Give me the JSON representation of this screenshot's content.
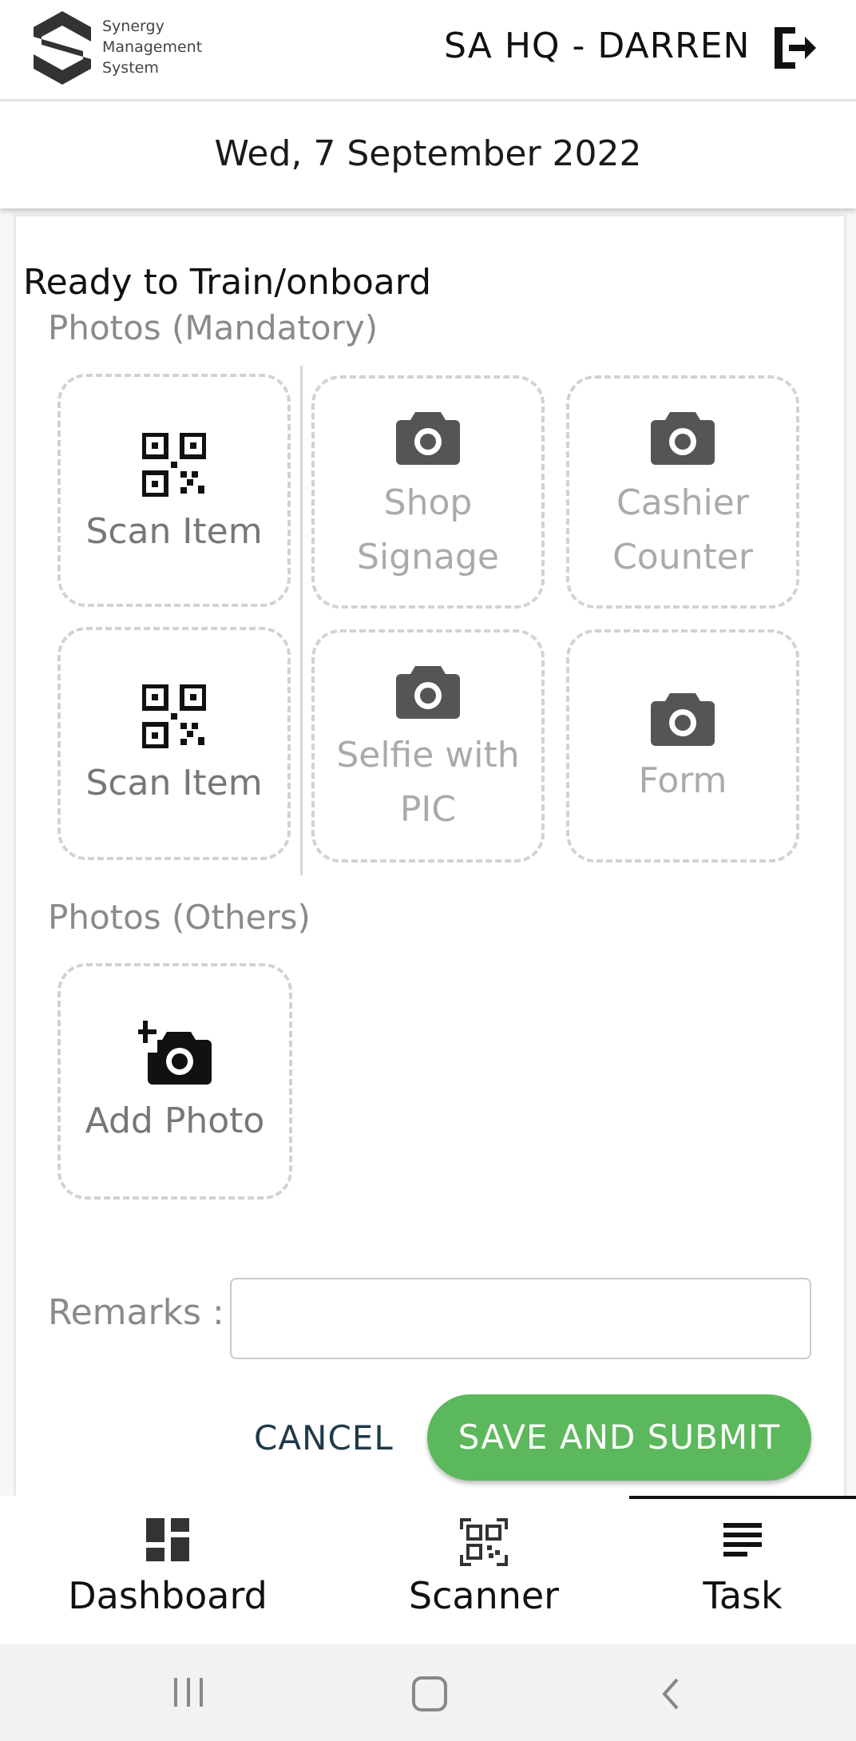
{
  "header": {
    "logo_text": [
      "Synergy",
      "Management",
      "System"
    ],
    "user": "SA HQ - DARREN"
  },
  "date": "Wed, 7 September 2022",
  "task": {
    "title": "Ready to Train/onboard",
    "photos_mandatory_label": "Photos (Mandatory)",
    "tiles": [
      {
        "label": "Scan Item",
        "icon": "qr-code-icon"
      },
      {
        "label": "Shop Signage",
        "icon": "camera-icon"
      },
      {
        "label": "Cashier Counter",
        "icon": "camera-icon"
      },
      {
        "label": "Scan Item",
        "icon": "qr-code-icon"
      },
      {
        "label": "Selfie with PIC",
        "icon": "camera-icon"
      },
      {
        "label": "Form",
        "icon": "camera-icon"
      }
    ],
    "photos_others_label": "Photos (Others)",
    "add_photo_label": "Add Photo",
    "remarks_label": "Remarks :",
    "remarks_value": "",
    "cancel_label": "CANCEL",
    "submit_label": "SAVE AND SUBMIT"
  },
  "bottom_nav": {
    "items": [
      {
        "label": "Dashboard",
        "icon": "dashboard-icon"
      },
      {
        "label": "Scanner",
        "icon": "qr-scanner-icon"
      },
      {
        "label": "Task",
        "icon": "task-list-icon"
      }
    ],
    "active": "Task"
  },
  "colors": {
    "accent_green": "#5cb85c",
    "tile_border": "#d2d2d2"
  }
}
